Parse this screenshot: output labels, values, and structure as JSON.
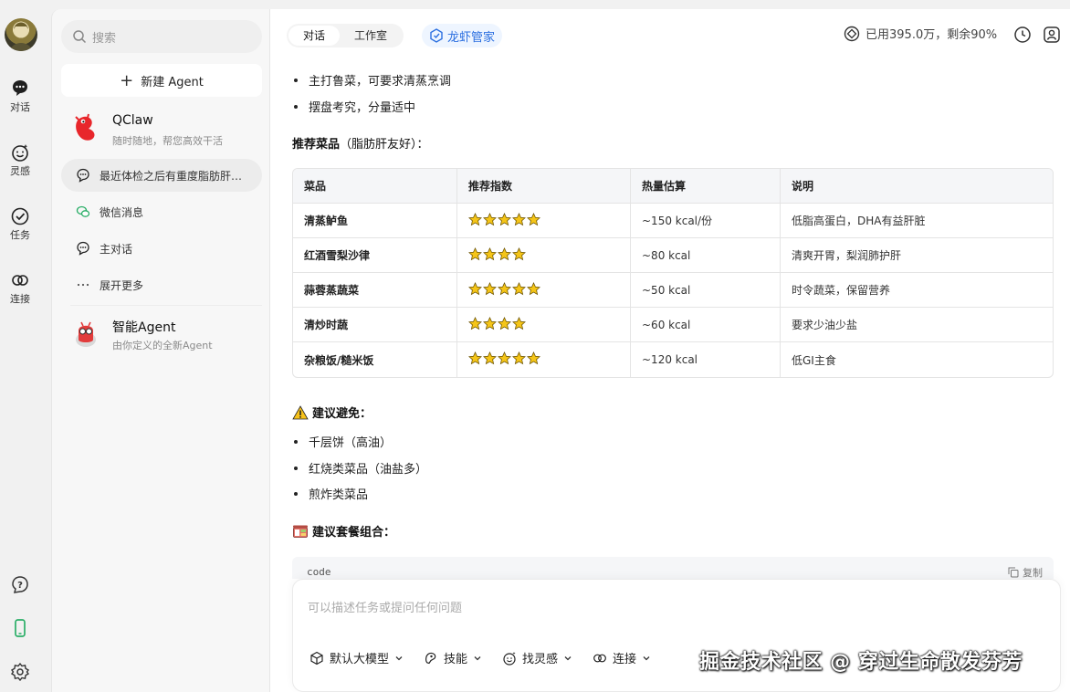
{
  "rail": {
    "items": [
      {
        "label": "对话",
        "icon": "chat-bubble-icon"
      },
      {
        "label": "灵感",
        "icon": "smile-sparkle-icon"
      },
      {
        "label": "任务",
        "icon": "check-circle-icon"
      },
      {
        "label": "连接",
        "icon": "link-icon"
      }
    ],
    "bottom_icons": [
      "help-icon",
      "phone-icon",
      "settings-icon"
    ]
  },
  "sidebar": {
    "search_placeholder": "搜索",
    "new_agent_label": "新建 Agent",
    "qclaw": {
      "name": "QClaw",
      "subtitle": "随时随地，帮您高效干活"
    },
    "rows": [
      {
        "label": "最近体检之后有重度脂肪肝…",
        "icon": "chat-dots-icon",
        "active": true
      },
      {
        "label": "微信消息",
        "icon": "wechat-icon",
        "active": false
      },
      {
        "label": "主对话",
        "icon": "chat-dots-icon",
        "active": false
      },
      {
        "label": "展开更多",
        "icon": "more-dots-icon",
        "active": false
      }
    ],
    "smart_agent": {
      "name": "智能Agent",
      "subtitle": "由你定义的全新Agent"
    }
  },
  "header": {
    "tabs": [
      {
        "label": "对话",
        "active": true
      },
      {
        "label": "工作室",
        "active": false
      }
    ],
    "lobster_label": "龙虾管家",
    "usage_text": "已用395.0万，剩余90%"
  },
  "content": {
    "bullets_top": [
      "主打鲁菜，可要求清蒸烹调",
      "摆盘考究，分量适中"
    ],
    "recommend_heading": "推荐菜品",
    "recommend_note": "（脂肪肝友好）：",
    "table": {
      "headers": [
        "菜品",
        "推荐指数",
        "热量估算",
        "说明"
      ],
      "rows": [
        {
          "dish": "清蒸鲈鱼",
          "stars": 5,
          "kcal": "~150 kcal/份",
          "note": "低脂高蛋白，DHA有益肝脏"
        },
        {
          "dish": "红酒雪梨沙律",
          "stars": 4,
          "kcal": "~80 kcal",
          "note": "清爽开胃，梨润肺护肝"
        },
        {
          "dish": "蒜蓉蒸蔬菜",
          "stars": 5,
          "kcal": "~50 kcal",
          "note": "时令蔬菜，保留营养"
        },
        {
          "dish": "清炒时蔬",
          "stars": 4,
          "kcal": "~60 kcal",
          "note": "要求少油少盐"
        },
        {
          "dish": "杂粮饭/糙米饭",
          "stars": 5,
          "kcal": "~120 kcal",
          "note": "低GI主食"
        }
      ]
    },
    "avoid_heading": "建议避免：",
    "avoid_items": [
      "千层饼（高油）",
      "红烧类菜品（油盐多）",
      "煎炸类菜品"
    ],
    "combo_heading": "建议套餐组合：",
    "code_lang": "code",
    "copy_label": "复制"
  },
  "composer": {
    "placeholder": "可以描述任务或提问任何问题",
    "tools": [
      {
        "label": "默认大模型",
        "icon": "cube-icon"
      },
      {
        "label": "技能",
        "icon": "skill-icon"
      },
      {
        "label": "找灵感",
        "icon": "smile-sparkle-icon"
      },
      {
        "label": "连接",
        "icon": "link-icon"
      }
    ]
  },
  "watermark": "掘金技术社区 @ 穿过生命散发芬芳",
  "colors": {
    "accent": "#2b6fe0",
    "star": "#f5c518",
    "wechat": "#2aae67"
  }
}
